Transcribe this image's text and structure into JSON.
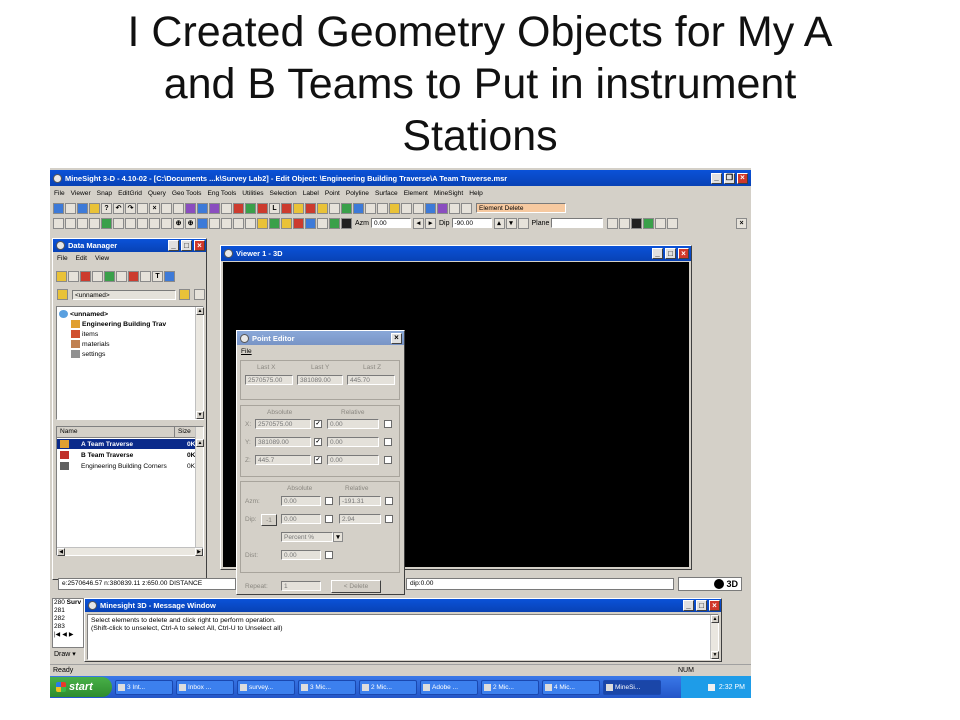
{
  "slide": {
    "title_lines": [
      "I Created Geometry Objects for My A",
      "and B Teams to Put in instrument",
      "Stations"
    ]
  },
  "main_window": {
    "title": "MineSight 3-D  - 4.10-02 - [C:\\Documents ...k\\Survey Lab2] - Edit Object: \\Engineering Building Traverse\\A Team Traverse.msr",
    "menu": [
      "File",
      "Viewer",
      "Snap",
      "EditGrid",
      "Query",
      "Geo Tools",
      "Eng Tools",
      "Utilities",
      "Selection",
      "Label",
      "Point",
      "Polyline",
      "Surface",
      "Element",
      "MineSight",
      "Help"
    ],
    "operation_field": "Element Delete",
    "azm_label": "Azm",
    "azm_value": "0.00",
    "dip_label": "Dip",
    "dip_value": "-90.00",
    "plane_label": "Plane"
  },
  "data_manager": {
    "title": "Data Manager",
    "menu": [
      "File",
      "Edit",
      "View"
    ],
    "path_field": "<unnamed>",
    "tree": {
      "root": "<unnamed>",
      "folder": "Engineering Building Trav",
      "children": [
        "items",
        "materials",
        "settings"
      ]
    },
    "list_headers": {
      "name": "Name",
      "size": "Size"
    },
    "list": [
      {
        "name": "A Team Traverse",
        "size": "0K",
        "selected": true
      },
      {
        "name": "B Team Traverse",
        "size": "0K",
        "selected": false
      },
      {
        "name": "Engineering Building Corners",
        "size": "0K",
        "selected": false
      }
    ]
  },
  "viewer": {
    "title": "Viewer 1 - 3D"
  },
  "point_editor": {
    "title": "Point Editor",
    "menu_file": "File",
    "last_headers": [
      "Last X",
      "Last Y",
      "Last Z"
    ],
    "last_values": [
      "2570575.00",
      "381089.00",
      "445.70"
    ],
    "abs_header": "Absolute",
    "rel_header": "Relative",
    "coords": [
      {
        "label": "X:",
        "abs": "2570575.00",
        "rel": "0.00"
      },
      {
        "label": "Y:",
        "abs": "381089.00",
        "rel": "0.00"
      },
      {
        "label": "Z:",
        "abs": "445.7",
        "rel": "0.00"
      }
    ],
    "azm_label": "Azm:",
    "azm_abs": "0.00",
    "azm_rel": "-191.31",
    "dip_label": "Dip:",
    "dip_step": "-1",
    "dip_abs": "0.00",
    "dip_rel": "2.94",
    "percent_option": "Percent %",
    "dist_label": "Dist:",
    "dist_value": "0.00",
    "repeat_label": "Repeat:",
    "repeat_value": "1",
    "delete_button": "< Delete"
  },
  "status_line": {
    "coords": "e:2570646.57   n:380839.11   z:650.00   DISTANCE",
    "dip": "dip:0.00",
    "badge": "3D"
  },
  "left_rows": [
    "280",
    "281",
    "282",
    "283"
  ],
  "left_row_label": "Surv",
  "draw_label": "Draw",
  "message_window": {
    "title": "Minesight 3D - Message Window",
    "lines": [
      "Select elements to delete and click right to perform operation.",
      "(Shift-click to unselect, Ctrl-A to select All, Ctrl-U to Unselect all)"
    ]
  },
  "statusbar": {
    "ready": "Ready",
    "num": "NUM"
  },
  "taskbar": {
    "start": "start",
    "tasks": [
      "3 Int...",
      "Inbox ...",
      "survey...",
      "3 Mic...",
      "2 Mic...",
      "Adobe ...",
      "2 Mic...",
      "4 Mic...",
      "MineSi..."
    ],
    "clock": "2:32 PM"
  },
  "colors": {
    "titlebar": "#0a52d8",
    "viewport": "#000000",
    "taskbar": "#2456c8",
    "start": "#3a9a3a"
  }
}
